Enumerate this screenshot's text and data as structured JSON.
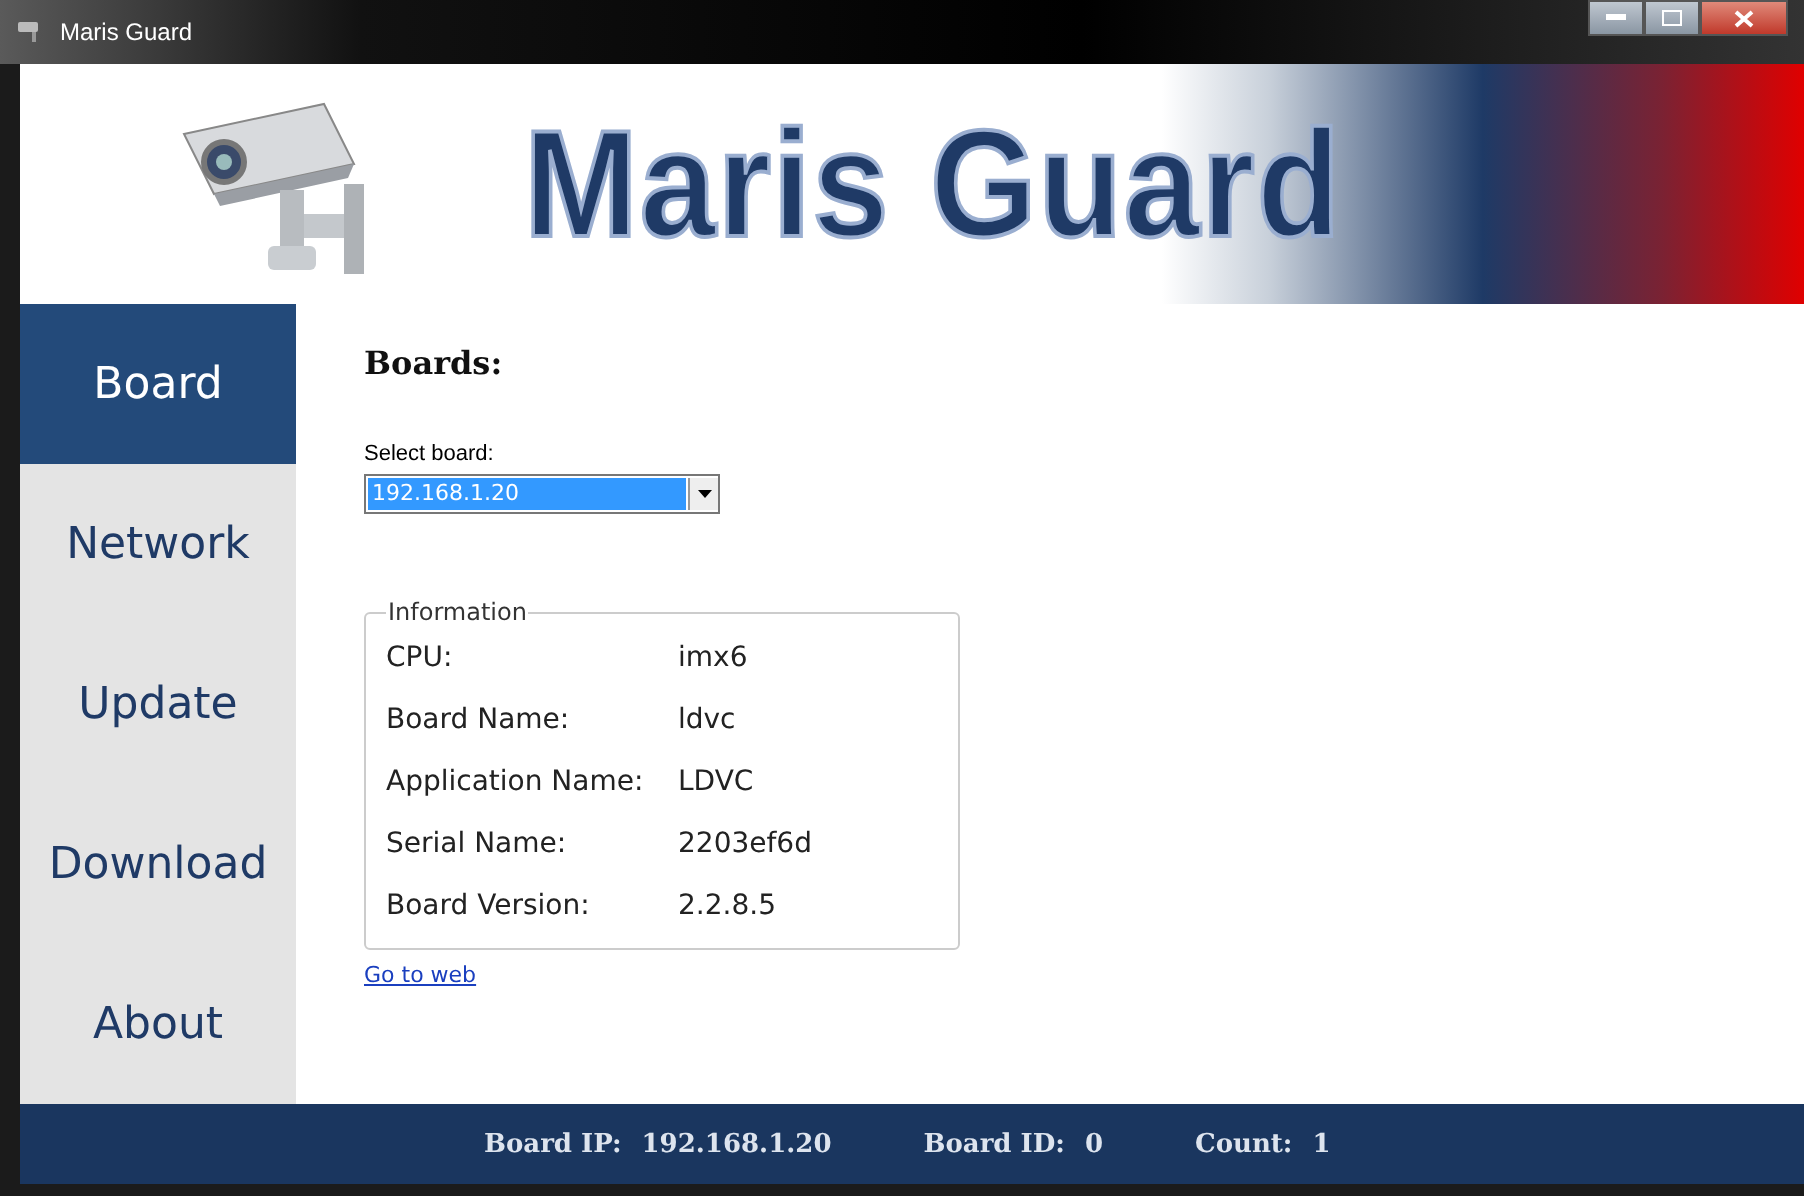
{
  "window": {
    "title": "Maris Guard"
  },
  "banner": {
    "logo_text": "Maris Guard"
  },
  "sidebar": {
    "items": [
      {
        "label": "Board",
        "selected": true
      },
      {
        "label": "Network",
        "selected": false
      },
      {
        "label": "Update",
        "selected": false
      },
      {
        "label": "Download",
        "selected": false
      },
      {
        "label": "About",
        "selected": false
      }
    ]
  },
  "content": {
    "heading": "Boards:",
    "select_label": "Select board:",
    "select_value": "192.168.1.20",
    "info": {
      "legend": "Information",
      "rows": [
        {
          "label": "CPU:",
          "value": "imx6"
        },
        {
          "label": "Board Name:",
          "value": "ldvc"
        },
        {
          "label": "Application Name:",
          "value": "LDVC"
        },
        {
          "label": "Serial Name:",
          "value": "2203ef6d"
        },
        {
          "label": "Board Version:",
          "value": "2.2.8.5"
        }
      ]
    },
    "link": "Go to web"
  },
  "status_bar": [
    {
      "label": "Board IP:",
      "value": "192.168.1.20"
    },
    {
      "label": "Board ID:",
      "value": "0"
    },
    {
      "label": "Count:",
      "value": "1"
    }
  ]
}
